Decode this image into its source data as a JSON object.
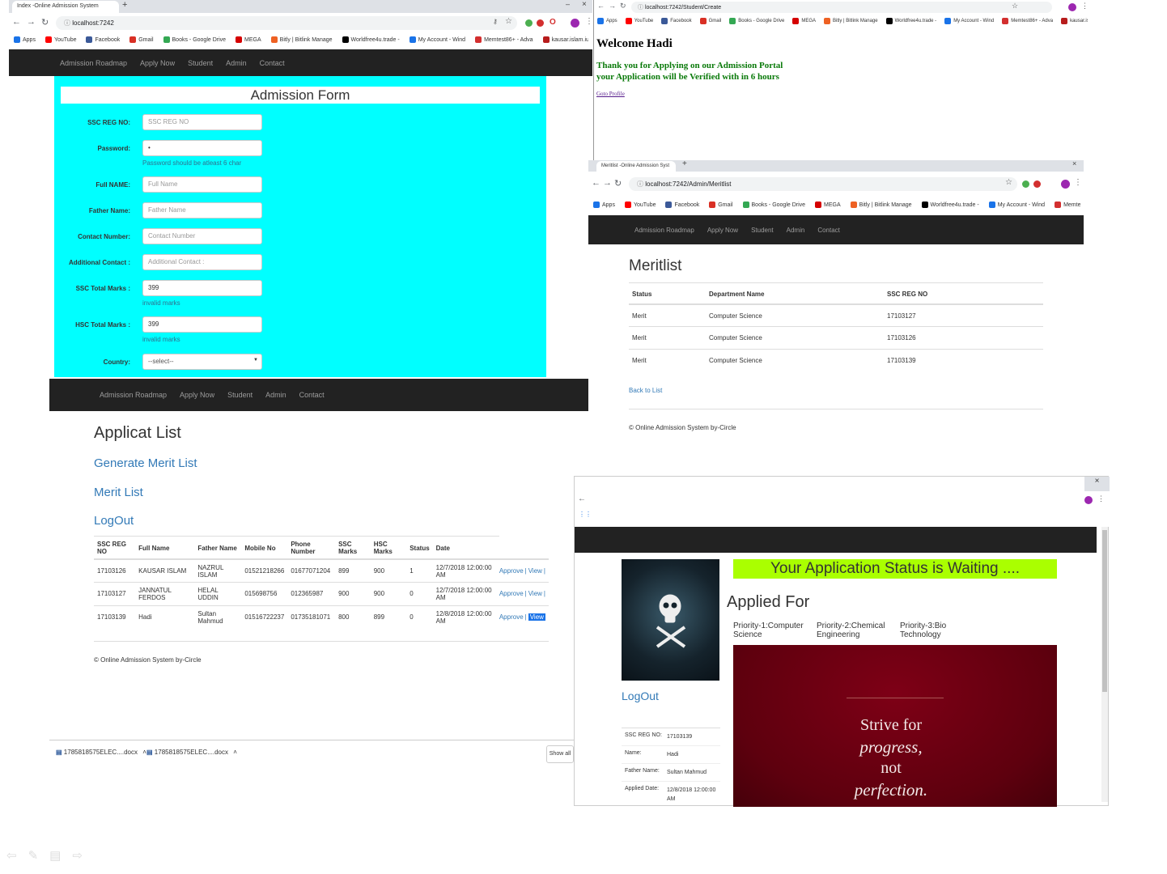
{
  "colors": {
    "form_bg": "#00ffff",
    "navbar": "#222222",
    "status_banner": "#aaff00",
    "thanks_text": "#0a7a0a",
    "link": "#337ab7",
    "poster_bg": "#7a0010"
  },
  "win1": {
    "tab_title": "Index -Online Admission System",
    "url": "localhost:7242",
    "bookmarks": [
      "Apps",
      "YouTube",
      "Facebook",
      "Gmail",
      "Books - Google Drive",
      "MEGA",
      "Bitly | Bitlink Manage",
      "Worldfree4u.trade -",
      "My Account - Wind",
      "Memtest86+ - Adva",
      "kausar.islam.iubat@"
    ],
    "nav": [
      "Admission Roadmap",
      "Apply Now",
      "Student",
      "Admin",
      "Contact"
    ],
    "form": {
      "title": "Admission Form",
      "fields": [
        {
          "label": "SSC REG NO:",
          "value": "SSC REG NO",
          "error": ""
        },
        {
          "label": "Password:",
          "value": "•",
          "error": "Password should be atleast 6 char"
        },
        {
          "label": "Full NAME:",
          "value": "Full Name",
          "error": ""
        },
        {
          "label": "Father Name:",
          "value": "Father Name",
          "error": ""
        },
        {
          "label": "Contact Number:",
          "value": "Contact Number",
          "error": ""
        },
        {
          "label": "Additional Contact :",
          "value": "Additional Contact :",
          "error": ""
        },
        {
          "label": "SSC Total Marks :",
          "value": "399",
          "error": "invalid marks"
        },
        {
          "label": "HSC Total Marks :",
          "value": "399",
          "error": "invalid marks"
        },
        {
          "label": "Country:",
          "value": "--select--",
          "error": ""
        }
      ]
    }
  },
  "win2": {
    "url": "localhost:7242/Student/Create",
    "bookmarks": [
      "Apps",
      "YouTube",
      "Facebook",
      "Gmail",
      "Books - Google Drive",
      "MEGA",
      "Bitly | Bitlink Manage",
      "Worldfree4u.trade -",
      "My Account - Wind",
      "Memtest86+ - Adva",
      "kausar.islam.iubat@"
    ],
    "welcome": "Welcome Hadi",
    "thanks1": "Thank you for Applying on our Admission Portal",
    "thanks2": "your Application will be Verified with in 6 hours",
    "goto": "Goto Profile"
  },
  "win3": {
    "tab_title": "Meritlist -Online Admission Syst",
    "url": "localhost:7242/Admin/Meritlist",
    "bookmarks": [
      "Apps",
      "YouTube",
      "Facebook",
      "Gmail",
      "Books - Google Drive",
      "MEGA",
      "Bitly | Bitlink Manage",
      "Worldfree4u.trade -",
      "My Account - Wind",
      "Memtest86+ - Adva",
      "kausar.islam.iubat@"
    ],
    "nav": [
      "Admission Roadmap",
      "Apply Now",
      "Student",
      "Admin",
      "Contact"
    ],
    "heading": "Meritlist",
    "columns": [
      "Status",
      "Department Name",
      "SSC REG NO"
    ],
    "rows": [
      [
        "Merit",
        "Computer Science",
        "17103127"
      ],
      [
        "Merit",
        "Computer Science",
        "17103126"
      ],
      [
        "Merit",
        "Computer Science",
        "17103139"
      ]
    ],
    "back": "Back to List",
    "footer": "© Online Admission System by-Circle"
  },
  "win4": {
    "nav": [
      "Admission Roadmap",
      "Apply Now",
      "Student",
      "Admin",
      "Contact"
    ],
    "heading": "Applicat List",
    "links": [
      "Generate Merit List",
      "Merit List",
      "LogOut"
    ],
    "columns": [
      "SSC REG NO",
      "Full Name",
      "Father Name",
      "Mobile No",
      "Phone Number",
      "SSC Marks",
      "HSC Marks",
      "Status",
      "Date",
      ""
    ],
    "rows": [
      [
        "17103126",
        "KAUSAR ISLAM",
        "NAZRUL ISLAM",
        "01521218266",
        "01677071204",
        "899",
        "900",
        "1",
        "12/7/2018 12:00:00 AM"
      ],
      [
        "17103127",
        "JANNATUL FERDOS",
        "HELAL UDDIN",
        "015698756",
        "012365987",
        "900",
        "900",
        "0",
        "12/7/2018 12:00:00 AM"
      ],
      [
        "17103139",
        "Hadi",
        "Sultan Mahmud",
        "01516722237",
        "01735181071",
        "800",
        "899",
        "0",
        "12/8/2018 12:00:00 AM"
      ]
    ],
    "approve": "Approve",
    "view": "View",
    "sep": "|",
    "footer": "© Online Admission System by-Circle",
    "downloads": [
      "1785818575ELEC....docx",
      "1785818575ELEC....docx"
    ],
    "show_all": "Show all"
  },
  "win5": {
    "status": "Your Application Status is Waiting ....",
    "applied_for": "Applied For",
    "priorities": [
      "Priority-1:Computer Science",
      "Priority-2:Chemical Engineering",
      "Priority-3:Bio Technology"
    ],
    "logout": "LogOut",
    "info": [
      [
        "SSC REG NO:",
        "17103139"
      ],
      [
        "Name:",
        "Hadi"
      ],
      [
        "Father Name:",
        "Sultan Mahmud"
      ],
      [
        "Applied Date:",
        "12/8/2018 12:00:00 AM"
      ]
    ],
    "poster_lines": [
      "Strive for",
      "progress,",
      "not",
      "perfection."
    ]
  }
}
